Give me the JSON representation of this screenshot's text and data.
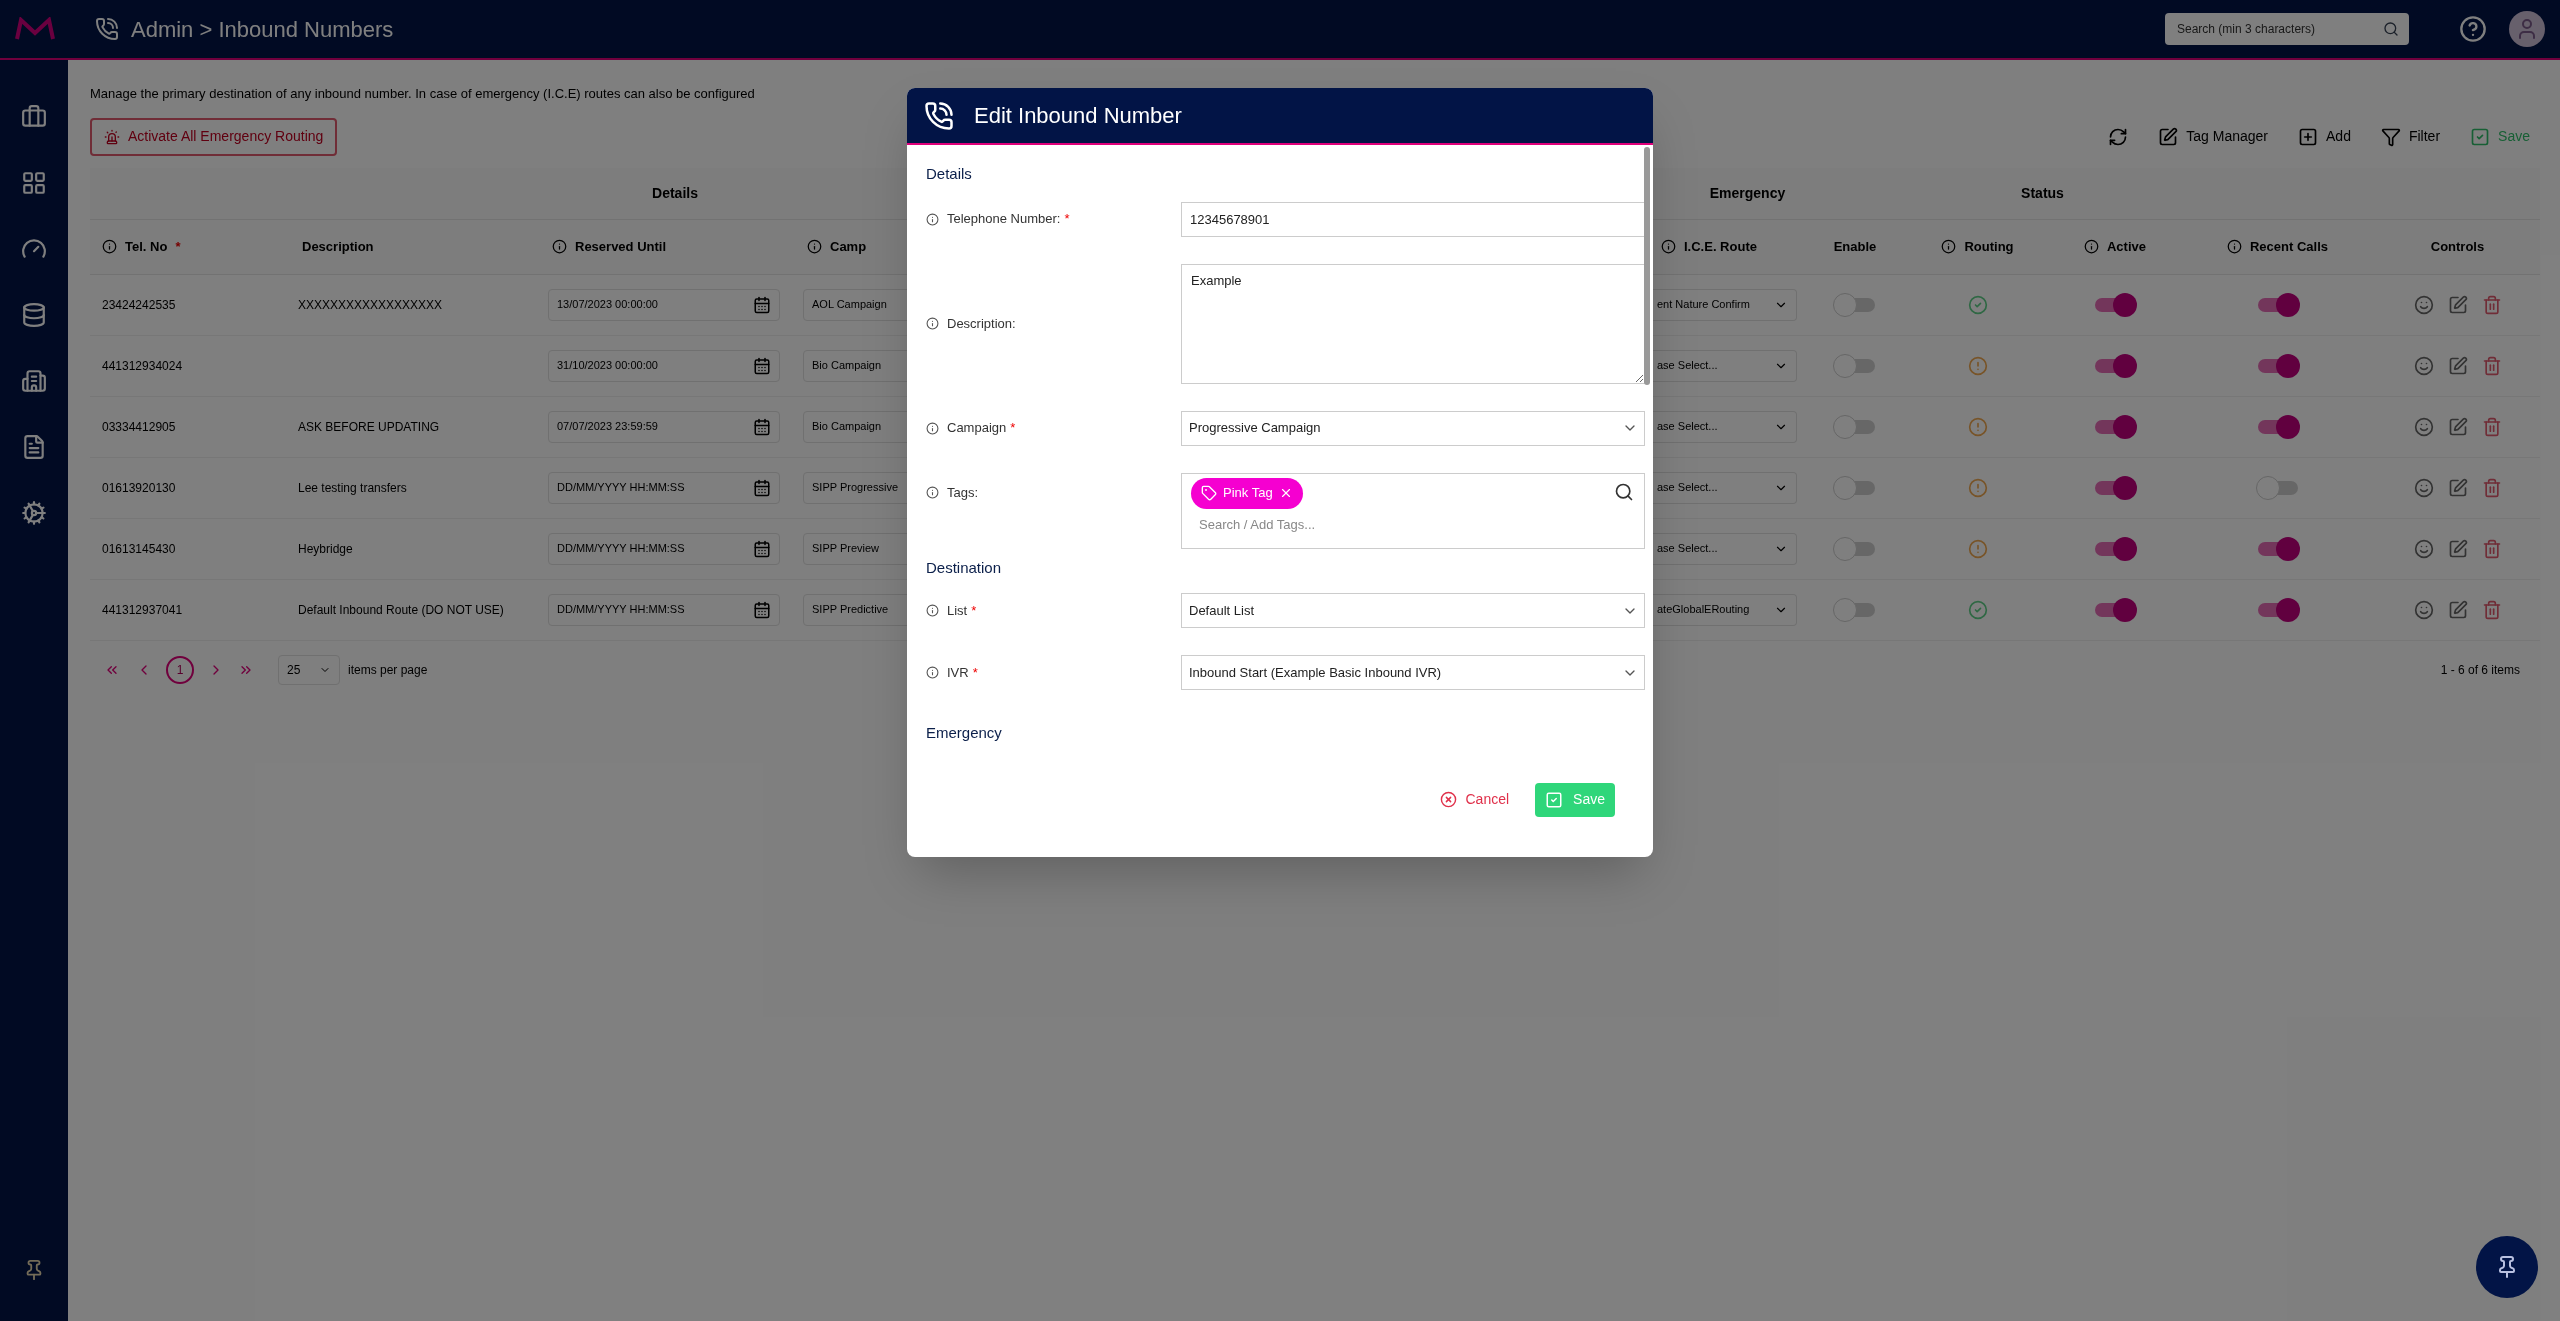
{
  "topbar": {
    "title": "Admin > Inbound Numbers",
    "search": {
      "placeholder": "Search (min 3 characters)"
    }
  },
  "page": {
    "intro": "Manage the primary destination of any inbound number. In case of emergency (I.C.E) routes can also be configured",
    "emergency_button": "Activate All Emergency Routing",
    "toolbar": [
      {
        "kind": "refresh",
        "disabled": false
      },
      {
        "kind": "tags",
        "label": "Tag Manager",
        "disabled": false
      },
      {
        "kind": "add",
        "label": "Add",
        "disabled": false
      },
      {
        "kind": "filter",
        "label": "Filter",
        "disabled": false
      },
      {
        "kind": "save",
        "label": "Save",
        "disabled": true
      }
    ]
  },
  "table": {
    "groups": [
      "Details",
      "Emergency",
      "Status"
    ],
    "columns": [
      {
        "label": "Tel. No",
        "info": true,
        "mark": "*"
      },
      {
        "label": "Description",
        "info": false
      },
      {
        "label": "Reserved Until",
        "info": true
      },
      {
        "label": "Camp",
        "info": true
      },
      {
        "label": "I.C.E. Route",
        "info": true
      },
      {
        "label": "Enable",
        "info": false
      },
      {
        "label": "Routing",
        "info": true
      },
      {
        "label": "Active",
        "info": true
      },
      {
        "label": "Recent Calls",
        "info": true
      },
      {
        "label": "Controls",
        "info": false
      }
    ],
    "rows": [
      {
        "tel": "23424242535",
        "description": "XXXXXXXXXXXXXXXXXX",
        "reserved_until": "13/07/2023 00:00:00",
        "campaign": "AOL Campaign",
        "ice_route": "ent Nature Confirm",
        "enable": false,
        "routing_ok": true,
        "active": true,
        "recent_calls": true
      },
      {
        "tel": "441312934024",
        "reserved_until": "31/10/2023 00:00:00",
        "campaign": "Bio Campaign",
        "ice_route": "ase Select...",
        "enable": false,
        "routing_ok": false,
        "active": true,
        "recent_calls": true
      },
      {
        "tel": "03334412905",
        "description": "ASK BEFORE UPDATING",
        "reserved_until": "07/07/2023 23:59:59",
        "campaign": "Bio Campaign",
        "ice_route": "ase Select...",
        "enable": false,
        "routing_ok": false,
        "active": true,
        "recent_calls": true
      },
      {
        "tel": "01613920130",
        "description": "Lee testing transfers",
        "reserved_until": "DD/MM/YYYY HH:MM:SS",
        "campaign": "SIPP Progressive",
        "ice_route": "ase Select...",
        "enable": false,
        "routing_ok": false,
        "active": true,
        "recent_calls": false
      },
      {
        "tel": "01613145430",
        "description": "Heybridge",
        "reserved_until": "DD/MM/YYYY HH:MM:SS",
        "campaign": "SIPP Preview",
        "ice_route": "ase Select...",
        "enable": false,
        "routing_ok": false,
        "active": true,
        "recent_calls": true
      },
      {
        "tel": "441312937041",
        "description": "Default Inbound Route (DO NOT USE)",
        "reserved_until": "DD/MM/YYYY HH:MM:SS",
        "campaign": "SIPP Predictive",
        "ice_route": "ateGlobalERouting",
        "enable": false,
        "routing_ok": true,
        "active": true,
        "recent_calls": true
      }
    ]
  },
  "pagination": {
    "page": "1",
    "page_size": "25",
    "page_size_label": "items per page",
    "summary": "1 - 6 of 6 items"
  },
  "modal": {
    "title": "Edit Inbound Number",
    "sections": [
      {
        "heading": "Details",
        "fields": [
          {
            "kind": "text",
            "label": "Telephone Number:",
            "mark": "*",
            "value": "12345678901"
          },
          {
            "kind": "textarea",
            "label": "Description:",
            "value": "Example"
          },
          {
            "kind": "select",
            "label": "Campaign",
            "mark": "*",
            "value": "Progressive Campaign"
          },
          {
            "kind": "tags",
            "label": "Tags:",
            "tags": [
              {
                "label": "Pink Tag",
                "color": "#f500d0"
              }
            ],
            "placeholder": "Search / Add Tags..."
          }
        ]
      },
      {
        "heading": "Destination",
        "fields": [
          {
            "kind": "select",
            "label": "List",
            "mark": "*",
            "value": "Default List"
          },
          {
            "kind": "select",
            "label": "IVR",
            "mark": "*",
            "value": "Inbound Start (Example Basic Inbound IVR)"
          }
        ]
      },
      {
        "heading": "Emergency"
      }
    ],
    "cancel": "Cancel",
    "save": "Save"
  }
}
